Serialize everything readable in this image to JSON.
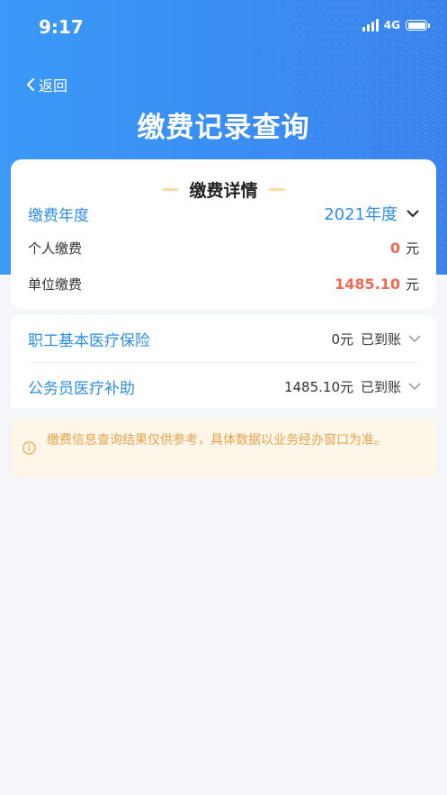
{
  "status_bar": {
    "time": "9:17",
    "network": "4G"
  },
  "header": {
    "back_label": "返回",
    "title": "缴费记录查询"
  },
  "detail_card": {
    "title": "缴费详情",
    "year_label": "缴费年度",
    "year_value": "2021年度",
    "rows": [
      {
        "label": "个人缴费",
        "amount": "0",
        "unit": "元"
      },
      {
        "label": "单位缴费",
        "amount": "1485.10",
        "unit": "元"
      }
    ]
  },
  "insurance_list": [
    {
      "name": "职工基本医疗保险",
      "amount": "0元",
      "status": "已到账"
    },
    {
      "name": "公务员医疗补助",
      "amount": "1485.10元",
      "status": "已到账"
    }
  ],
  "notice": {
    "text": "缴费信息查询结果仅供参考，具体数据以业务经办窗口为准。"
  },
  "colors": {
    "primary": "#3a8ff0",
    "accent_blue": "#2f8ee6",
    "amount_red": "#ee6a51",
    "notice_text": "#e8a34a",
    "notice_bg": "#fff6ea"
  }
}
